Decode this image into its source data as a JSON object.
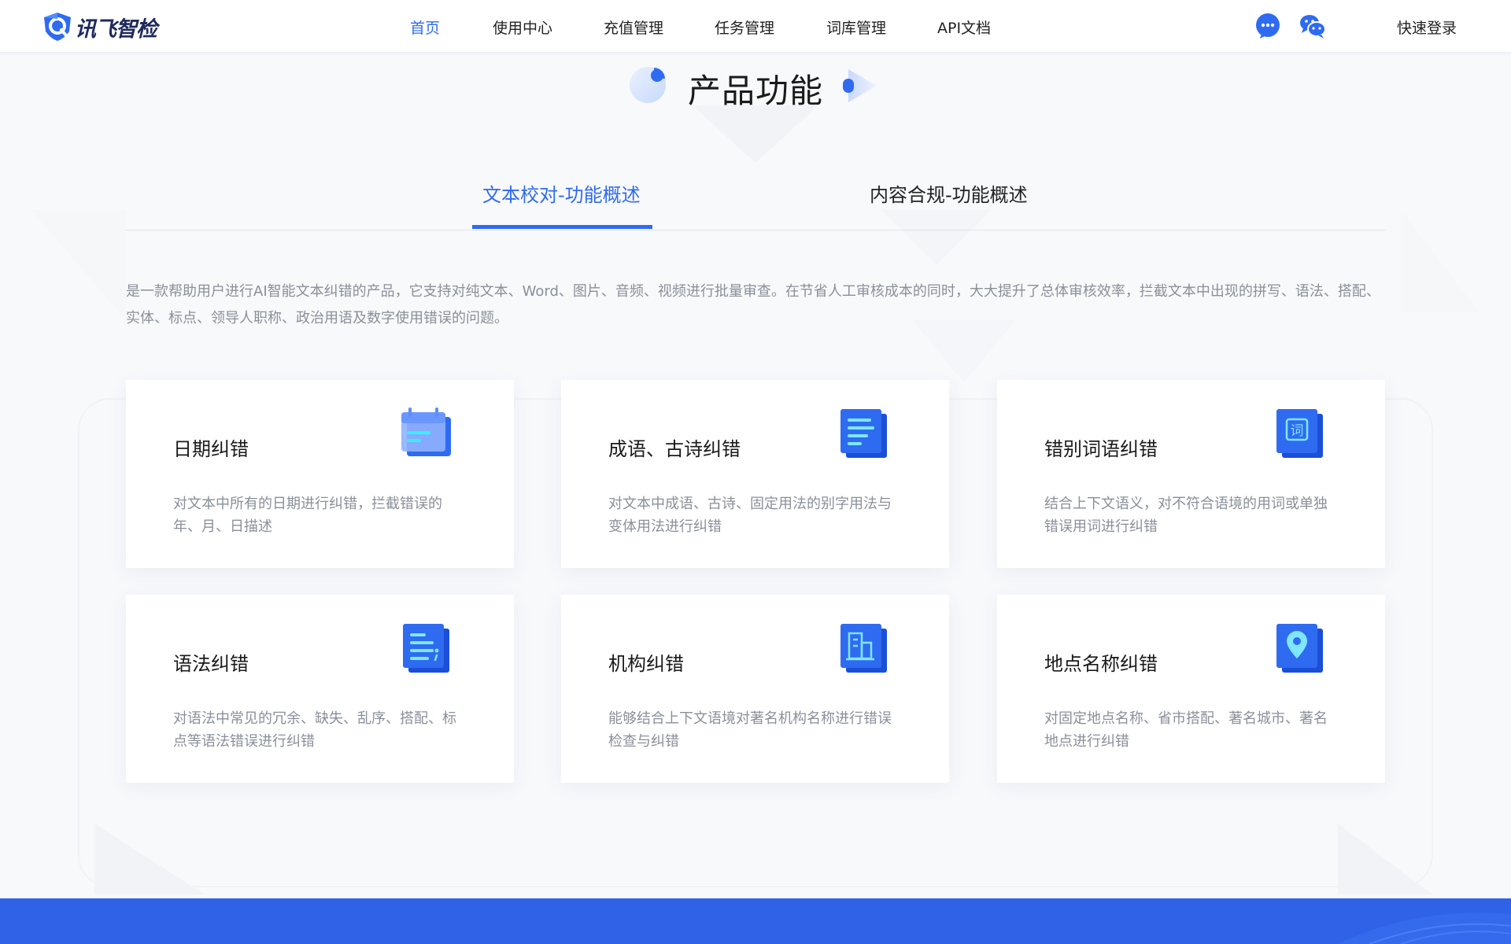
{
  "brand": {
    "name": "讯飞智检"
  },
  "nav": {
    "items": [
      {
        "label": "首页",
        "active": true
      },
      {
        "label": "使用中心",
        "active": false
      },
      {
        "label": "充值管理",
        "active": false
      },
      {
        "label": "任务管理",
        "active": false
      },
      {
        "label": "词库管理",
        "active": false
      },
      {
        "label": "API文档",
        "active": false
      }
    ],
    "icons": [
      "chat-bubble-icon",
      "wechat-icon"
    ],
    "login_label": "快速登录"
  },
  "section": {
    "title": "产品功能",
    "tabs": [
      {
        "label": "文本校对-功能概述",
        "active": true
      },
      {
        "label": "内容合规-功能概述",
        "active": false
      }
    ],
    "description": "是一款帮助用户进行AI智能文本纠错的产品，它支持对纯文本、Word、图片、音频、视频进行批量审查。在节省人工审核成本的同时，大大提升了总体审核效率，拦截文本中出现的拼写、语法、搭配、实体、标点、领导人职称、政治用语及数字使用错误的问题。"
  },
  "cards": [
    {
      "title": "日期纠错",
      "text": "对文本中所有的日期进行纠错，拦截错误的年、月、日描述",
      "icon": "calendar-icon"
    },
    {
      "title": "成语、古诗纠错",
      "text": "对文本中成语、古诗、固定用法的别字用法与变体用法进行纠错",
      "icon": "document-lines-icon"
    },
    {
      "title": "错别词语纠错",
      "text": "结合上下文语义，对不符合语境的用词或单独错误用词进行纠错",
      "icon": "word-ci-icon",
      "icon_char": "词"
    },
    {
      "title": "语法纠错",
      "text": "对语法中常见的冗余、缺失、乱序、搭配、标点等语法错误进行纠错",
      "icon": "grammar-doc-icon"
    },
    {
      "title": "机构纠错",
      "text": "能够结合上下文语境对著名机构名称进行错误检查与纠错",
      "icon": "building-icon"
    },
    {
      "title": "地点名称纠错",
      "text": "对固定地点名称、省市搭配、著名城市、著名地点进行纠错",
      "icon": "location-pin-icon"
    }
  ],
  "colors": {
    "accent": "#2f6bf0",
    "footer": "#2f62e6",
    "text_muted": "#8a8f99",
    "background": "#f8f9fb"
  }
}
